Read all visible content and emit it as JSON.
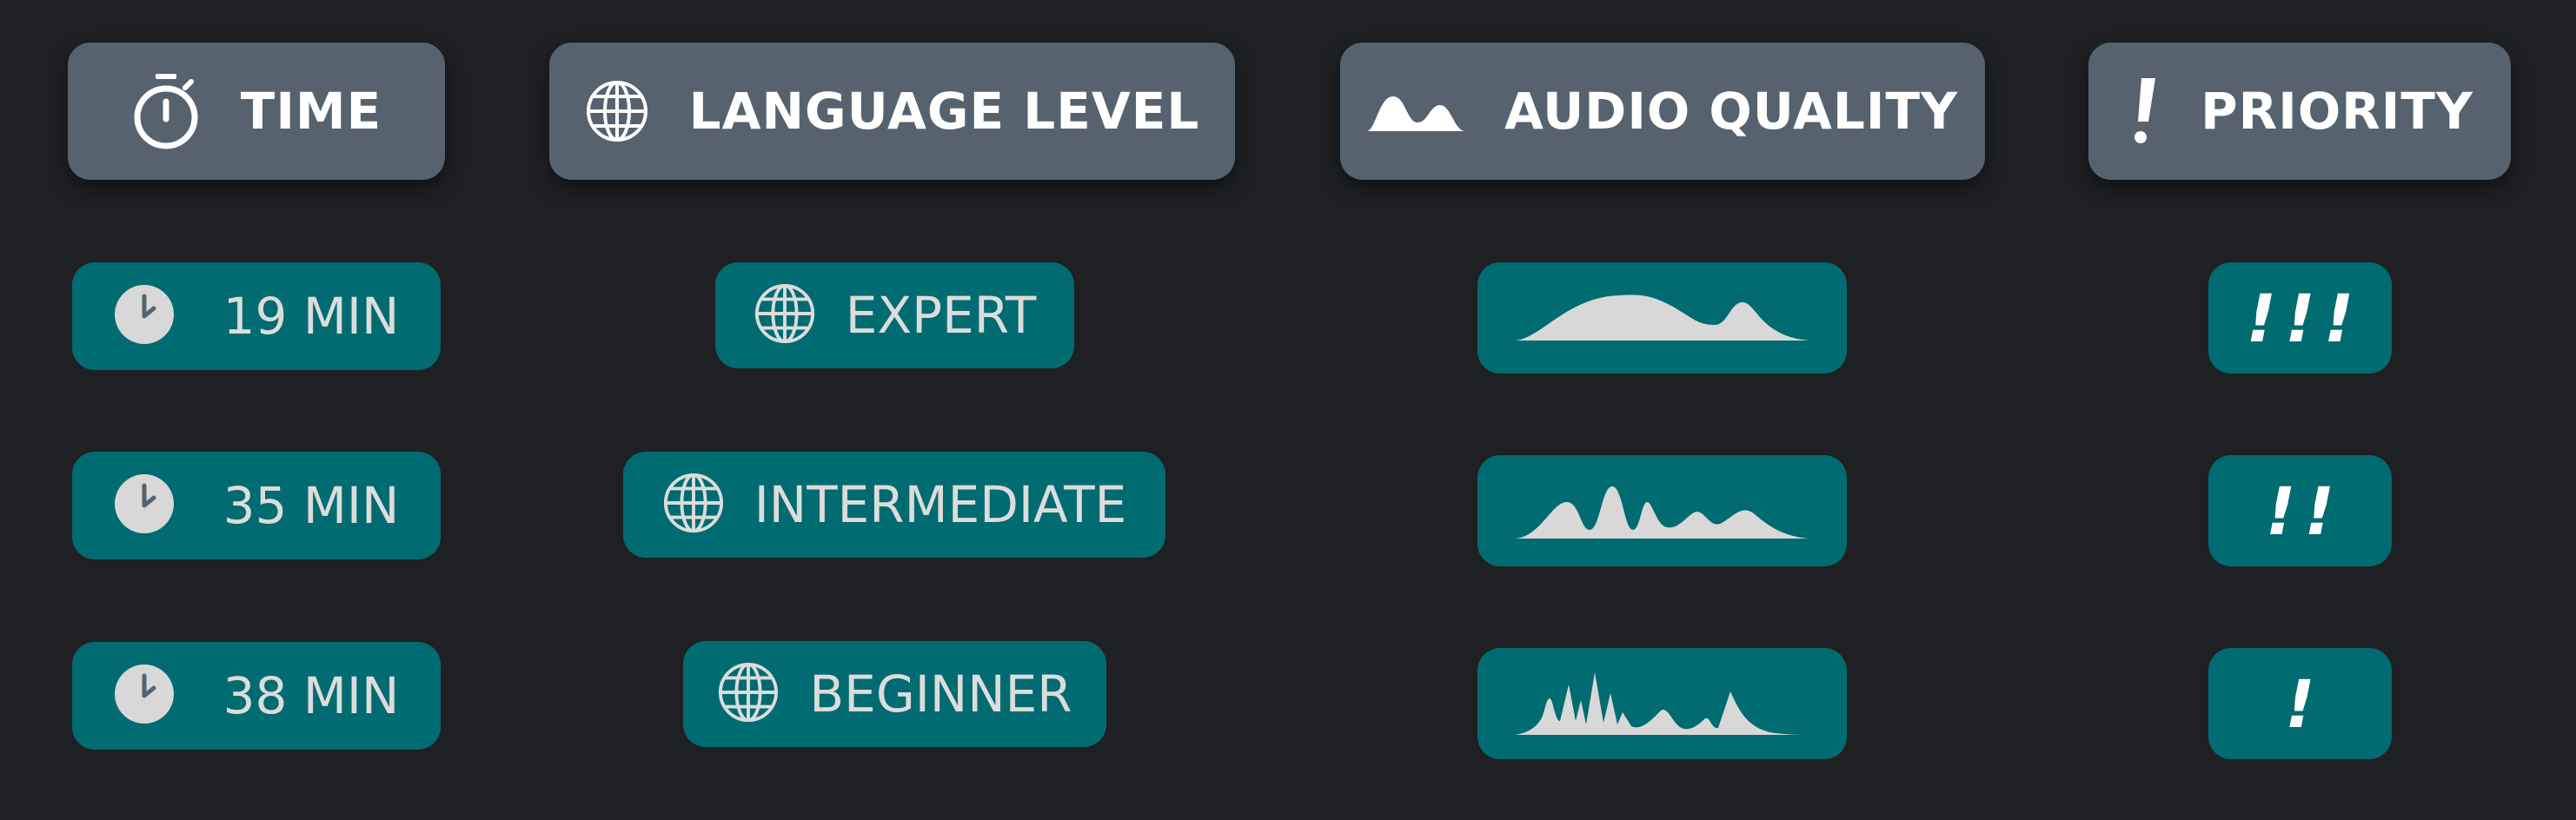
{
  "headers": {
    "time": "TIME",
    "language_level": "LANGUAGE LEVEL",
    "audio_quality": "AUDIO QUALITY",
    "priority": "PRIORITY"
  },
  "rows": [
    {
      "time": "19 MIN",
      "level": "EXPERT",
      "audio_waveform": "smooth-wave-icon",
      "priority": "!!!"
    },
    {
      "time": "35 MIN",
      "level": "INTERMEDIATE",
      "audio_waveform": "bumpy-wave-icon",
      "priority": "!!"
    },
    {
      "time": "38 MIN",
      "level": "BEGINNER",
      "audio_waveform": "spiky-wave-icon",
      "priority": "!"
    }
  ],
  "colors": {
    "background": "#1f2023",
    "header": "#56636e",
    "pill": "#006b70",
    "pill_text": "#dcdcdc",
    "icon_fill": "#d8d8d8"
  }
}
